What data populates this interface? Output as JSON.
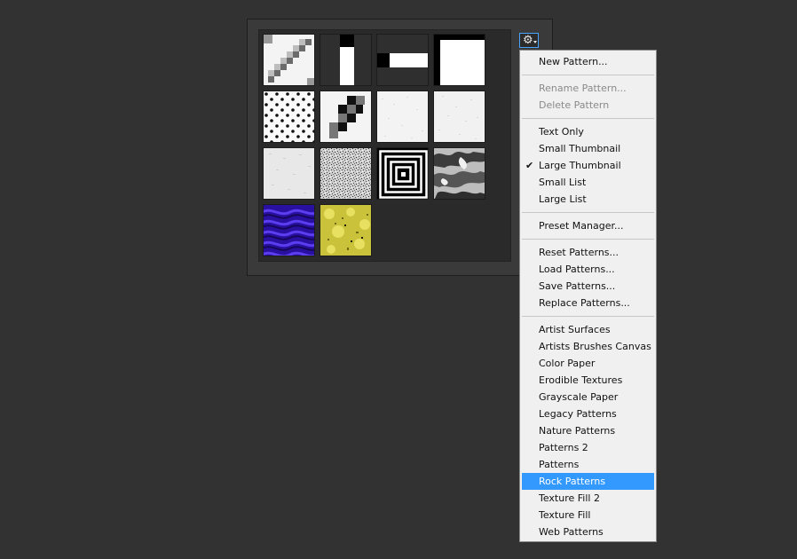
{
  "pattern_panel": {
    "settings_button": {
      "icon": "gear-icon",
      "caret": "chevron-down-icon"
    }
  },
  "menu": {
    "groups": [
      [
        {
          "label": "New Pattern...",
          "enabled": true
        }
      ],
      [
        {
          "label": "Rename Pattern...",
          "enabled": false
        },
        {
          "label": "Delete Pattern",
          "enabled": false
        }
      ],
      [
        {
          "label": "Text Only",
          "enabled": true
        },
        {
          "label": "Small Thumbnail",
          "enabled": true
        },
        {
          "label": "Large Thumbnail",
          "enabled": true,
          "checked": true
        },
        {
          "label": "Small List",
          "enabled": true
        },
        {
          "label": "Large List",
          "enabled": true
        }
      ],
      [
        {
          "label": "Preset Manager...",
          "enabled": true
        }
      ],
      [
        {
          "label": "Reset Patterns...",
          "enabled": true
        },
        {
          "label": "Load Patterns...",
          "enabled": true
        },
        {
          "label": "Save Patterns...",
          "enabled": true
        },
        {
          "label": "Replace Patterns...",
          "enabled": true
        }
      ],
      [
        {
          "label": "Artist Surfaces",
          "enabled": true
        },
        {
          "label": "Artists Brushes Canvas",
          "enabled": true
        },
        {
          "label": "Color Paper",
          "enabled": true
        },
        {
          "label": "Erodible Textures",
          "enabled": true
        },
        {
          "label": "Grayscale Paper",
          "enabled": true
        },
        {
          "label": "Legacy Patterns",
          "enabled": true
        },
        {
          "label": "Nature Patterns",
          "enabled": true
        },
        {
          "label": "Patterns 2",
          "enabled": true
        },
        {
          "label": "Patterns",
          "enabled": true
        },
        {
          "label": "Rock Patterns",
          "enabled": true,
          "highlighted": true
        },
        {
          "label": "Texture Fill 2",
          "enabled": true
        },
        {
          "label": "Texture Fill",
          "enabled": true
        },
        {
          "label": "Web Patterns",
          "enabled": true
        }
      ]
    ],
    "check_glyph": "✔"
  },
  "colors": {
    "highlight": "#3399ff",
    "menu_bg": "#f0f0f0",
    "app_bg": "#323232"
  }
}
